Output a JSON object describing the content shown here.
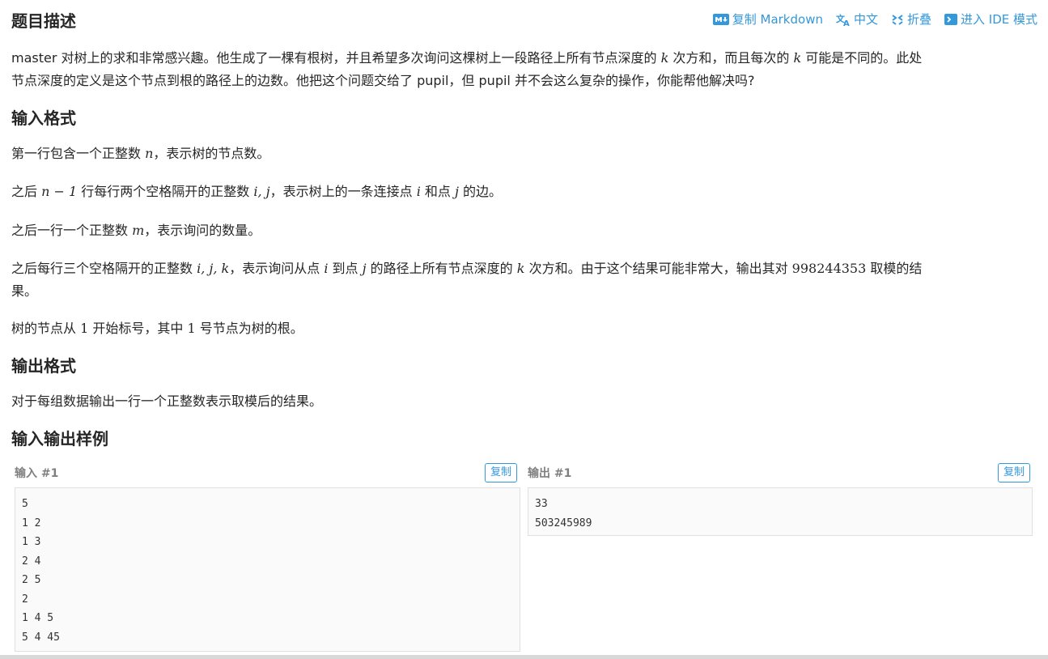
{
  "header": {
    "title": "题目描述"
  },
  "toolbar": {
    "copy_markdown": "复制 Markdown",
    "language": "中文",
    "fold": "折叠",
    "ide": "进入 IDE 模式"
  },
  "description": {
    "p1_a": "master 对树上的求和非常感兴趣。他生成了一棵有根树，并且希望多次询问这棵树上一段路径上所有节点深度的 ",
    "p1_k": "k",
    "p1_b": " 次方和，而且每次的 ",
    "p1_k2": "k",
    "p1_c": " 可能是不同的。此处",
    "p1_line2": "节点深度的定义是这个节点到根的路径上的边数。他把这个问题交给了 pupil，但 pupil 并不会这么复杂的操作，你能帮他解决吗?"
  },
  "input_format": {
    "title": "输入格式",
    "l1_a": "第一行包含一个正整数 ",
    "l1_n": "n",
    "l1_b": "，表示树的节点数。",
    "l2_a": "之后 ",
    "l2_expr": "n − 1",
    "l2_b": " 行每行两个空格隔开的正整数 ",
    "l2_ij": "i, j",
    "l2_c": "，表示树上的一条连接点 ",
    "l2_i": "i",
    "l2_d": " 和点 ",
    "l2_j": "j",
    "l2_e": " 的边。",
    "l3_a": "之后一行一个正整数 ",
    "l3_m": "m",
    "l3_b": "，表示询问的数量。",
    "l4_a": "之后每行三个空格隔开的正整数 ",
    "l4_ijk": "i, j, k",
    "l4_b": "，表示询问从点 ",
    "l4_i": "i",
    "l4_c": " 到点 ",
    "l4_j": "j",
    "l4_d": " 的路径上所有节点深度的 ",
    "l4_k": "k",
    "l4_e": " 次方和。由于这个结果可能非常大，输出其对 ",
    "l4_mod": "998244353",
    "l4_f": " 取模的结",
    "l4_line2": "果。",
    "l5_a": "树的节点从 ",
    "l5_one": "1",
    "l5_b": " 开始标号，其中 ",
    "l5_one2": "1",
    "l5_c": " 号节点为树的根。"
  },
  "output_format": {
    "title": "输出格式",
    "text": "对于每组数据输出一行一个正整数表示取模后的结果。"
  },
  "samples": {
    "title": "输入输出样例",
    "input_label": "输入 #1",
    "output_label": "输出 #1",
    "copy": "复制",
    "input": "5\n1 2\n1 3\n2 4\n2 5\n2\n1 4 5\n5 4 45",
    "output": "33\n503245989"
  }
}
